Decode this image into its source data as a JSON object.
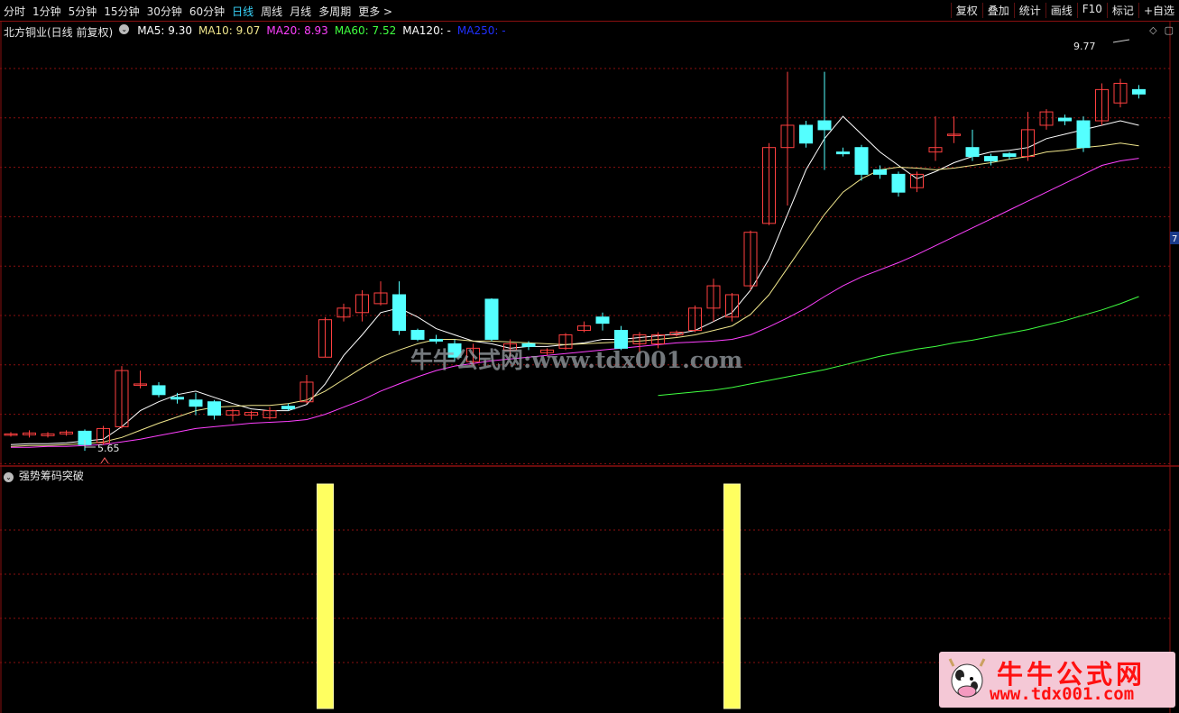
{
  "toolbar": {
    "periods": [
      "分时",
      "1分钟",
      "5分钟",
      "15分钟",
      "30分钟",
      "60分钟",
      "日线",
      "周线",
      "月线",
      "多周期",
      "更多 >"
    ],
    "active_index": 6,
    "right_buttons": [
      "复权",
      "叠加",
      "统计",
      "画线",
      "F10",
      "标记",
      "+自选"
    ]
  },
  "info": {
    "stock": "北方铜业(日线 前复权)",
    "ma": [
      {
        "label": "MA5: 9.30",
        "color": "#ffffff"
      },
      {
        "label": "MA10: 9.07",
        "color": "#f0e68c"
      },
      {
        "label": "MA20: 8.93",
        "color": "#ff40ff"
      },
      {
        "label": "MA60: 7.52",
        "color": "#40ff40"
      },
      {
        "label": "MA120: -",
        "color": "#ffffff"
      },
      {
        "label": "MA250: -",
        "color": "#2030ff"
      }
    ]
  },
  "price": {
    "high_label": "9.77",
    "low_label": "5.65",
    "ymin": 5.5,
    "ymax": 10.3,
    "right_marker": "7"
  },
  "indicator": {
    "title": "强势筹码突破",
    "bars_at_candle_index": [
      17,
      39
    ]
  },
  "watermark": "牛牛公式网:www.tdx001.com",
  "logo": {
    "title": "牛牛公式网",
    "url": "www.tdx001.com"
  },
  "colors": {
    "up": "#ff4040",
    "down": "#54ffff",
    "grid": "#8a1010",
    "bar": "#ffff60"
  },
  "candles": [
    [
      5.83,
      5.84,
      5.81,
      5.86
    ],
    [
      5.83,
      5.85,
      5.8,
      5.88
    ],
    [
      5.82,
      5.84,
      5.8,
      5.86
    ],
    [
      5.84,
      5.86,
      5.82,
      5.88
    ],
    [
      5.87,
      5.72,
      5.65,
      5.89
    ],
    [
      5.74,
      5.9,
      5.72,
      5.93
    ],
    [
      5.92,
      6.55,
      5.9,
      6.6
    ],
    [
      6.4,
      6.4,
      6.35,
      6.55
    ],
    [
      6.38,
      6.28,
      6.25,
      6.42
    ],
    [
      6.25,
      6.23,
      6.18,
      6.3
    ],
    [
      6.22,
      6.15,
      6.05,
      6.3
    ],
    [
      6.2,
      6.05,
      6.0,
      6.22
    ],
    [
      6.05,
      6.1,
      5.98,
      6.12
    ],
    [
      6.05,
      6.08,
      6.0,
      6.1
    ],
    [
      6.02,
      6.1,
      6.0,
      6.14
    ],
    [
      6.15,
      6.12,
      6.1,
      6.18
    ],
    [
      6.2,
      6.42,
      6.18,
      6.5
    ],
    [
      6.7,
      7.12,
      6.7,
      7.15
    ],
    [
      7.15,
      7.25,
      7.1,
      7.3
    ],
    [
      7.2,
      7.4,
      7.1,
      7.45
    ],
    [
      7.3,
      7.42,
      7.28,
      7.55
    ],
    [
      7.4,
      7.0,
      6.95,
      7.55
    ],
    [
      7.0,
      6.9,
      6.88,
      7.02
    ],
    [
      6.9,
      6.88,
      6.85,
      6.95
    ],
    [
      6.85,
      6.7,
      6.65,
      6.9
    ],
    [
      6.65,
      6.8,
      6.6,
      6.85
    ],
    [
      7.35,
      6.9,
      6.88,
      7.36
    ],
    [
      6.78,
      6.85,
      6.7,
      6.9
    ],
    [
      6.85,
      6.82,
      6.78,
      6.88
    ],
    [
      6.75,
      6.78,
      6.72,
      6.8
    ],
    [
      6.8,
      6.95,
      6.78,
      6.97
    ],
    [
      7.0,
      7.05,
      6.98,
      7.1
    ],
    [
      7.15,
      7.08,
      7.0,
      7.2
    ],
    [
      7.0,
      6.8,
      6.78,
      7.05
    ],
    [
      6.85,
      6.95,
      6.75,
      6.98
    ],
    [
      6.85,
      6.95,
      6.8,
      6.98
    ],
    [
      6.95,
      6.98,
      6.93,
      7.0
    ],
    [
      7.0,
      7.25,
      6.98,
      7.28
    ],
    [
      7.25,
      7.5,
      7.1,
      7.58
    ],
    [
      7.15,
      7.4,
      7.1,
      7.42
    ],
    [
      7.5,
      8.1,
      7.45,
      8.12
    ],
    [
      8.2,
      9.05,
      8.18,
      9.1
    ],
    [
      9.05,
      9.3,
      8.4,
      9.9
    ],
    [
      9.3,
      9.1,
      9.05,
      9.35
    ],
    [
      9.35,
      9.25,
      8.8,
      9.9
    ],
    [
      9.0,
      8.98,
      8.95,
      9.05
    ],
    [
      9.05,
      8.75,
      8.68,
      9.08
    ],
    [
      8.8,
      8.75,
      8.7,
      8.85
    ],
    [
      8.75,
      8.55,
      8.5,
      8.78
    ],
    [
      8.6,
      8.75,
      8.55,
      8.78
    ],
    [
      9.0,
      9.05,
      8.9,
      9.4
    ],
    [
      9.2,
      9.2,
      9.1,
      9.4
    ],
    [
      9.05,
      8.95,
      8.9,
      9.25
    ],
    [
      8.95,
      8.9,
      8.85,
      8.98
    ],
    [
      8.98,
      8.95,
      8.92,
      9.0
    ],
    [
      8.95,
      9.25,
      8.9,
      9.45
    ],
    [
      9.3,
      9.45,
      9.25,
      9.48
    ],
    [
      9.38,
      9.35,
      9.3,
      9.42
    ],
    [
      9.35,
      9.05,
      9.0,
      9.4
    ],
    [
      9.35,
      9.7,
      9.3,
      9.77
    ],
    [
      9.55,
      9.77,
      9.5,
      9.82
    ],
    [
      9.7,
      9.65,
      9.6,
      9.75
    ]
  ],
  "ma_series": {
    "ma5": {
      "color": "#ffffff",
      "start": 0,
      "values": [
        5.72,
        5.73,
        5.73,
        5.74,
        5.76,
        5.78,
        5.92,
        6.1,
        6.2,
        6.28,
        6.32,
        6.25,
        6.18,
        6.12,
        6.1,
        6.1,
        6.17,
        6.4,
        6.72,
        6.95,
        7.2,
        7.25,
        7.15,
        7.02,
        6.95,
        6.88,
        6.85,
        6.8,
        6.82,
        6.82,
        6.84,
        6.86,
        6.9,
        6.9,
        6.92,
        6.94,
        6.96,
        7.0,
        7.1,
        7.2,
        7.45,
        7.8,
        8.3,
        8.8,
        9.15,
        9.4,
        9.2,
        9.0,
        8.85,
        8.7,
        8.78,
        8.88,
        8.95,
        9.0,
        9.02,
        9.05,
        9.15,
        9.2,
        9.25,
        9.3,
        9.35,
        9.3
      ]
    },
    "ma10": {
      "color": "#f0e68c",
      "start": 0,
      "values": [
        5.7,
        5.71,
        5.71,
        5.72,
        5.73,
        5.75,
        5.8,
        5.88,
        5.96,
        6.03,
        6.1,
        6.14,
        6.15,
        6.16,
        6.16,
        6.18,
        6.22,
        6.32,
        6.45,
        6.58,
        6.7,
        6.78,
        6.85,
        6.9,
        6.9,
        6.88,
        6.88,
        6.87,
        6.86,
        6.85,
        6.84,
        6.85,
        6.86,
        6.87,
        6.88,
        6.9,
        6.92,
        6.95,
        7.0,
        7.05,
        7.18,
        7.4,
        7.7,
        8.0,
        8.3,
        8.55,
        8.7,
        8.8,
        8.83,
        8.82,
        8.8,
        8.82,
        8.85,
        8.88,
        8.92,
        8.95,
        9.0,
        9.02,
        9.05,
        9.07,
        9.1,
        9.07
      ]
    },
    "ma20": {
      "color": "#ff40ff",
      "start": 0,
      "values": [
        5.69,
        5.69,
        5.7,
        5.7,
        5.71,
        5.72,
        5.75,
        5.78,
        5.82,
        5.86,
        5.9,
        5.92,
        5.94,
        5.96,
        5.97,
        5.98,
        6.0,
        6.06,
        6.14,
        6.22,
        6.32,
        6.4,
        6.48,
        6.55,
        6.6,
        6.63,
        6.66,
        6.68,
        6.7,
        6.72,
        6.74,
        6.76,
        6.78,
        6.8,
        6.82,
        6.84,
        6.86,
        6.87,
        6.88,
        6.9,
        6.95,
        7.04,
        7.14,
        7.25,
        7.38,
        7.5,
        7.6,
        7.68,
        7.76,
        7.85,
        7.95,
        8.05,
        8.15,
        8.25,
        8.35,
        8.45,
        8.55,
        8.65,
        8.75,
        8.85,
        8.9,
        8.93
      ]
    },
    "ma60": {
      "color": "#40ff40",
      "start": 35,
      "values": [
        6.27,
        6.29,
        6.31,
        6.33,
        6.36,
        6.4,
        6.44,
        6.48,
        6.52,
        6.56,
        6.61,
        6.66,
        6.71,
        6.75,
        6.79,
        6.82,
        6.86,
        6.89,
        6.93,
        6.97,
        7.01,
        7.06,
        7.11,
        7.17,
        7.23,
        7.3,
        7.38
      ]
    }
  }
}
